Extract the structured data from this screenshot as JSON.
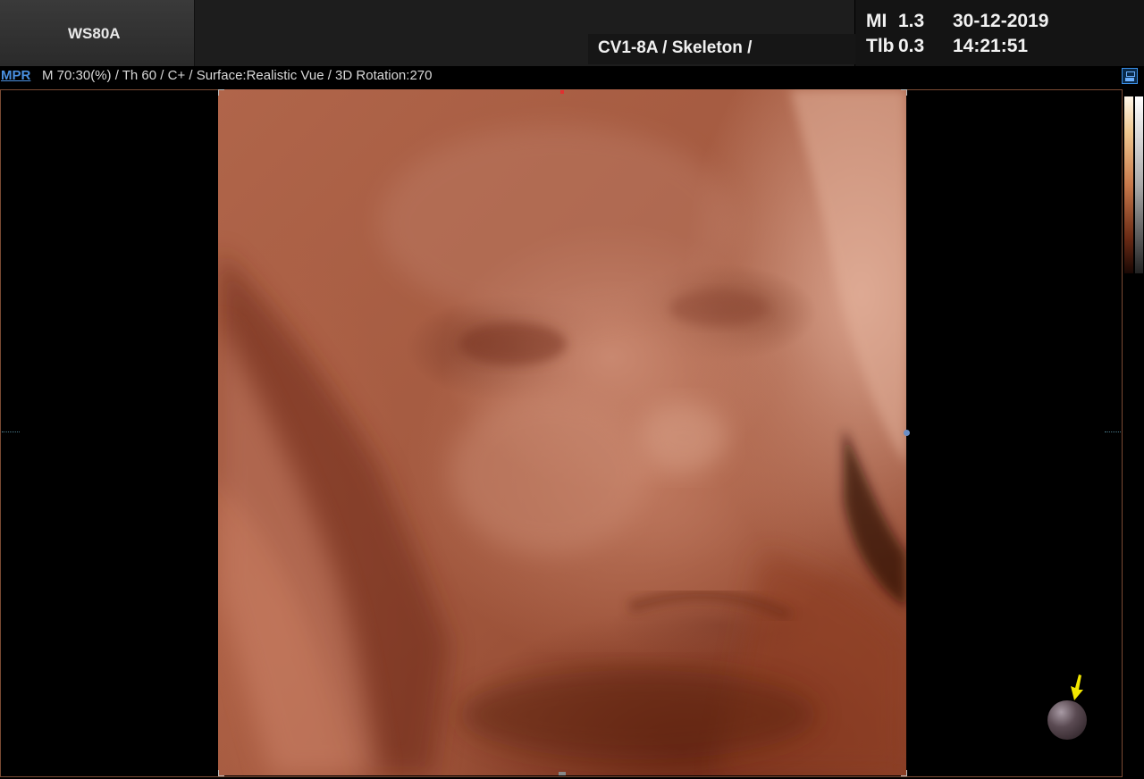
{
  "header": {
    "device_name": "WS80A",
    "probe_preset": "CV1-8A / Skeleton /",
    "mi_label": "MI",
    "mi_value": "1.3",
    "tib_label": "Tlb",
    "tib_value": "0.3",
    "date": "30-12-2019",
    "time": "14:21:51"
  },
  "mode_bar": {
    "mode": "MPR",
    "parameters": "M 70:30(%) / Th 60 / C+ / Surface:Realistic Vue / 3D Rotation:270"
  },
  "viewer": {
    "image_description_icon": "3d-render",
    "light_direction_icon": "light-sphere-icon",
    "arrow_color": "#f2e600"
  },
  "colors": {
    "mode_accent": "#4a90e0",
    "frame_border": "#7a4a33",
    "render_skin": "#b0654a"
  }
}
